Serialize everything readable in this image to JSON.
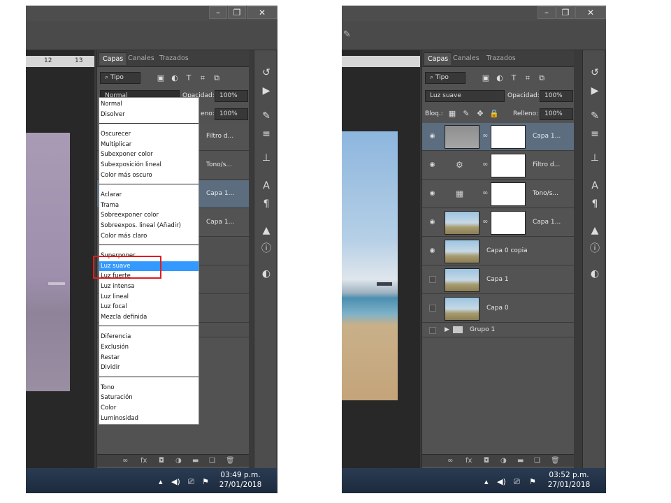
{
  "left": {
    "ruler": {
      "ticks": [
        "12",
        "13"
      ]
    },
    "panel": {
      "tabs": [
        "Capas",
        "Canales",
        "Trazados"
      ],
      "filter": "Tipo",
      "blend_mode": "Normal",
      "opacity_label": "Opacidad:",
      "opacity_value": "100%",
      "fill_label_partial": "eno:",
      "fill_value": "100%",
      "layer_names": [
        "Filtro d...",
        "Tono/s...",
        "Capa 1...",
        "Capa 1..."
      ]
    },
    "blend_menu": {
      "groups": [
        [
          "Normal",
          "Disolver"
        ],
        [
          "Oscurecer",
          "Multiplicar",
          "Subexponer color",
          "Subexposición lineal",
          "Color más oscuro"
        ],
        [
          "Aclarar",
          "Trama",
          "Sobreexponer color",
          "Sobreexpos. lineal (Añadir)",
          "Color más claro"
        ],
        [
          "Superponer",
          "Luz suave",
          "Luz fuerte",
          "Luz intensa",
          "Luz lineal",
          "Luz focal",
          "Mezcla definida"
        ],
        [
          "Diferencia",
          "Exclusión",
          "Restar",
          "Dividir"
        ],
        [
          "Tono",
          "Saturación",
          "Color",
          "Luminosidad"
        ]
      ],
      "highlighted": "Luz suave"
    },
    "taskbar": {
      "time": "03:49 p.m.",
      "date": "27/01/2018"
    }
  },
  "right": {
    "panel": {
      "tabs": [
        "Capas",
        "Canales",
        "Trazados"
      ],
      "filter": "Tipo",
      "blend_mode": "Luz suave",
      "opacity_label": "Opacidad:",
      "opacity_value": "100%",
      "lock_label": "Bloq.:",
      "fill_label": "Relleno:",
      "fill_value": "100%",
      "layers": [
        {
          "name": "Capa 1...",
          "selected": true
        },
        {
          "name": "Filtro d..."
        },
        {
          "name": "Tono/s..."
        },
        {
          "name": "Capa 1..."
        },
        {
          "name": "Capa 0 copia"
        },
        {
          "name": "Capa 1"
        },
        {
          "name": "Capa 0"
        },
        {
          "name": "Grupo 1"
        }
      ]
    },
    "taskbar": {
      "time": "03:52 p.m.",
      "date": "27/01/2018"
    }
  },
  "icons": {
    "minimize": "–",
    "maximize": "❐",
    "close": "✕",
    "eye": "◉",
    "chain": "∞",
    "folder": "▬",
    "caret": "▶"
  },
  "colors": {
    "highlight": "#3399ff",
    "annotation": "#e01c1c",
    "selected_layer": "#5c6d80"
  }
}
